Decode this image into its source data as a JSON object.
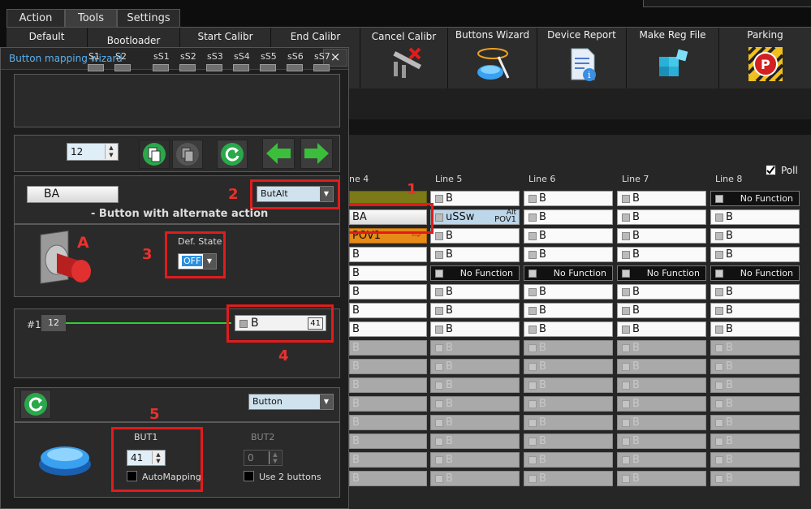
{
  "menu": {
    "tabs": [
      "Action",
      "Tools",
      "Settings"
    ],
    "active": "Tools"
  },
  "toolbar": {
    "items": [
      "Default",
      "Bootloader",
      "Start Calibr",
      "End Calibr",
      "Cancel Calibr",
      "Buttons Wizard",
      "Device Report",
      "Make Reg File",
      "Parking"
    ]
  },
  "grid": {
    "poll_label": "Poll",
    "poll_checked": true,
    "columns": [
      "ne 4",
      "Line 5",
      "Line 6",
      "Line 7",
      "Line 8"
    ],
    "col4": [
      "",
      "BA",
      "POV1",
      "B",
      "B",
      "B",
      "B",
      "B",
      "B",
      "B",
      "B",
      "B",
      "B",
      "B",
      "B",
      "B"
    ],
    "col5": [
      "B",
      "uSSw",
      "B",
      "B",
      "No Function",
      "B",
      "B",
      "B",
      "B",
      "B",
      "B",
      "B",
      "B",
      "B",
      "B",
      "B"
    ],
    "col6": [
      "B",
      "B",
      "B",
      "B",
      "No Function",
      "B",
      "B",
      "B",
      "B",
      "B",
      "B",
      "B",
      "B",
      "B",
      "B",
      "B"
    ],
    "col7": [
      "B",
      "B",
      "B",
      "B",
      "No Function",
      "B",
      "B",
      "B",
      "B",
      "B",
      "B",
      "B",
      "B",
      "B",
      "B",
      "B"
    ],
    "col8": [
      "No Function",
      "B",
      "B",
      "B",
      "No Function",
      "B",
      "B",
      "B",
      "B",
      "B",
      "B",
      "B",
      "B",
      "B",
      "B",
      "B"
    ],
    "alt_label": "Alt",
    "pov_label": "POV1"
  },
  "wizard": {
    "title": "Button mapping wizard",
    "close": "×",
    "leds": [
      "S1",
      "S2",
      "sS1",
      "sS2",
      "sS3",
      "sS4",
      "sS5",
      "sS6",
      "sS7"
    ],
    "button_number": "12",
    "ba_label": "BA",
    "type_select": "ButAlt",
    "description": "- Button with alternate action",
    "def_state_label": "Def. State",
    "def_state_value": "OFF",
    "line_index": "#1",
    "line_value": "12",
    "mapped_button": "B",
    "mapped_number": "41",
    "bottom_select": "Button",
    "but1_label": "BUT1",
    "but1_value": "41",
    "automapping_label": "AutoMapping",
    "but2_label": "BUT2",
    "but2_value": "0",
    "use2_label": "Use 2 buttons"
  },
  "annotations": {
    "n1": "1",
    "n2": "2",
    "n3": "3",
    "n4": "4",
    "n5": "5",
    "nA": "A"
  },
  "colors": {
    "accent_red": "#e21b1b",
    "title_blue": "#5ab0f0",
    "green_line": "#2fd02f"
  }
}
